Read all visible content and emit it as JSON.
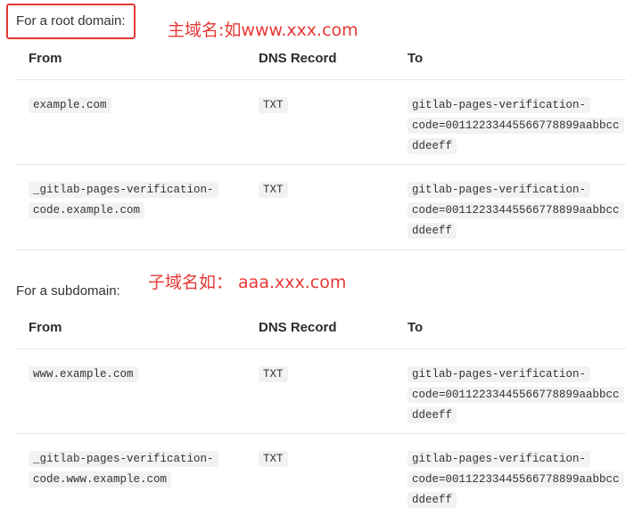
{
  "root_section": {
    "intro": "For a root domain:",
    "annotation": "主域名:如www.xxx.com",
    "headers": {
      "from": "From",
      "record": "DNS Record",
      "to": "To"
    },
    "rows": [
      {
        "from": [
          "example.com"
        ],
        "record": "TXT",
        "to": [
          "gitlab-pages-verification-",
          "code=00112233445566778899aabbcc",
          "ddeeff"
        ]
      },
      {
        "from": [
          "_gitlab-pages-verification-",
          "code.example.com"
        ],
        "record": "TXT",
        "to": [
          "gitlab-pages-verification-",
          "code=00112233445566778899aabbcc",
          "ddeeff"
        ]
      }
    ]
  },
  "sub_section": {
    "intro": "For a subdomain:",
    "annotation": "子域名如：  aaa.xxx.com",
    "headers": {
      "from": "From",
      "record": "DNS Record",
      "to": "To"
    },
    "rows": [
      {
        "from": [
          "www.example.com"
        ],
        "record": "TXT",
        "to": [
          "gitlab-pages-verification-",
          "code=00112233445566778899aabbcc",
          "ddeeff"
        ]
      },
      {
        "from": [
          "_gitlab-pages-verification-",
          "code.www.example.com"
        ],
        "record": "TXT",
        "to": [
          "gitlab-pages-verification-",
          "code=00112233445566778899aabbcc",
          "ddeeff"
        ]
      }
    ]
  },
  "highlight_color": "#e53935"
}
